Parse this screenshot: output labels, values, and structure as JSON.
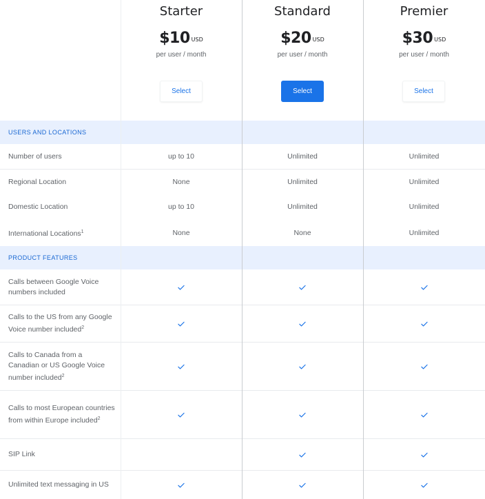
{
  "plans": [
    {
      "name": "Starter",
      "price": "$10",
      "currency": "USD",
      "period": "per user / month",
      "button": "Select",
      "button_style": "outline"
    },
    {
      "name": "Standard",
      "price": "$20",
      "currency": "USD",
      "period": "per user / month",
      "button": "Select",
      "button_style": "filled"
    },
    {
      "name": "Premier",
      "price": "$30",
      "currency": "USD",
      "period": "per user / month",
      "button": "Select",
      "button_style": "outline"
    }
  ],
  "sections": [
    {
      "title": "USERS AND LOCATIONS"
    },
    {
      "title": "PRODUCT FEATURES"
    }
  ],
  "rows": [
    {
      "label": "Number of users",
      "sup": "",
      "values": [
        "up to 10",
        "Unlimited",
        "Unlimited"
      ]
    },
    {
      "label": "Regional Location",
      "sup": "",
      "values": [
        "None",
        "Unlimited",
        "Unlimited"
      ]
    },
    {
      "label": "Domestic Location",
      "sup": "",
      "values": [
        "up to 10",
        "Unlimited",
        "Unlimited"
      ]
    },
    {
      "label": "International Locations",
      "sup": "1",
      "values": [
        "None",
        "None",
        "Unlimited"
      ]
    },
    {
      "label": "Calls between Google Voice numbers included",
      "sup": "",
      "values": [
        true,
        true,
        true
      ]
    },
    {
      "label": "Calls to the US from any Google Voice number included",
      "sup": "2",
      "values": [
        true,
        true,
        true
      ]
    },
    {
      "label": "Calls to Canada from a Canadian or US Google Voice number included",
      "sup": "2",
      "values": [
        true,
        true,
        true
      ]
    },
    {
      "label": "Calls to most European countries from within Europe included",
      "sup": "2",
      "values": [
        true,
        true,
        true
      ]
    },
    {
      "label": "SIP Link",
      "sup": "",
      "values": [
        false,
        true,
        true
      ]
    },
    {
      "label": "Unlimited text messaging in US",
      "sup": "",
      "values": [
        true,
        true,
        true
      ]
    }
  ],
  "icons": {
    "included": "checkmark-icon"
  },
  "colors": {
    "accent": "#1a73e8",
    "section_bg": "#e8f0fe",
    "section_text": "#1967d2",
    "check": "#1a73e8"
  }
}
